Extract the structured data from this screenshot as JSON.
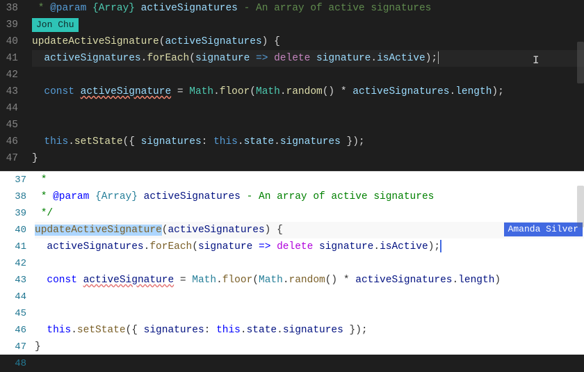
{
  "top": {
    "authorTag": "Jon Chu",
    "lineNumbers": [
      "38",
      "39",
      "40",
      "41",
      "42",
      "43",
      "44",
      "45",
      "46",
      "47"
    ],
    "cursor": {
      "line": 41,
      "ibeamLine": 41
    },
    "lines": {
      "l38": {
        "pre": " * ",
        "tag": "@param",
        "braceType": "{Array}",
        "name": "activeSignatures",
        "dash": " - ",
        "rest": "An array of active signatures"
      },
      "l40": {
        "fn": "updateActiveSignature",
        "open": "(",
        "p": "activeSignatures",
        "close": ") {"
      },
      "l41": {
        "indent": "  ",
        "obj": "activeSignatures",
        "dot1": ".",
        "fe": "forEach",
        "open": "(",
        "arg": "signature",
        "arrow": " => ",
        "del": "delete",
        "sp": " ",
        "obj2": "signature",
        "dot2": ".",
        "prop": "isActive",
        "end": ");"
      },
      "l43": {
        "indent": "  ",
        "kw": "const",
        "sp": " ",
        "name": "activeSignature",
        "eq": " = ",
        "m": "Math",
        "d1": ".",
        "fl": "floor",
        "op1": "(",
        "m2": "Math",
        "d2": ".",
        "rn": "random",
        "p": "() * ",
        "as": "activeSignatures",
        "d3": ".",
        "len": "length",
        "end": ");"
      },
      "l46": {
        "indent": "  ",
        "this": "this",
        "d1": ".",
        "ss": "setState",
        "op": "({ ",
        "key": "signatures",
        "col": ": ",
        "this2": "this",
        "d2": ".",
        "st": "state",
        "d3": ".",
        "sig": "signatures",
        "end": " });"
      },
      "l47": {
        "brace": "}"
      }
    }
  },
  "bottom": {
    "authorTag": "Amanda Silver",
    "lineNumbers": [
      "37",
      "38",
      "39",
      "40",
      "41",
      "42",
      "43",
      "44",
      "45",
      "46",
      "47",
      "48"
    ],
    "lines": {
      "l37": " *",
      "l38": {
        "pre": " * ",
        "tag": "@param",
        "braceType": "{Array}",
        "name": "activeSignatures",
        "dash": " - ",
        "rest": "An array of active signatures"
      },
      "l39": " */",
      "l40": {
        "fn": "updateActiveSignature",
        "open": "(",
        "p": "activeSignatures",
        "close": ") {"
      },
      "l41": {
        "indent": "  ",
        "obj": "activeSignatures",
        "dot1": ".",
        "fe": "forEach",
        "open": "(",
        "arg": "signature",
        "arrow": " => ",
        "del": "delete",
        "sp": " ",
        "obj2": "signature",
        "dot2": ".",
        "prop": "isActive",
        "end": ");"
      },
      "l43": {
        "indent": "  ",
        "kw": "const",
        "sp": " ",
        "name": "activeSignature",
        "eq": " = ",
        "m": "Math",
        "d1": ".",
        "fl": "floor",
        "op1": "(",
        "m2": "Math",
        "d2": ".",
        "rn": "random",
        "p": "() * ",
        "as": "activeSignatures",
        "d3": ".",
        "len": "length",
        "end": ")"
      },
      "l46": {
        "indent": "  ",
        "this": "this",
        "d1": ".",
        "ss": "setState",
        "op": "({ ",
        "key": "signatures",
        "col": ": ",
        "this2": "this",
        "d2": ".",
        "st": "state",
        "d3": ".",
        "sig": "signatures",
        "end": " });"
      },
      "l47": "}"
    }
  }
}
